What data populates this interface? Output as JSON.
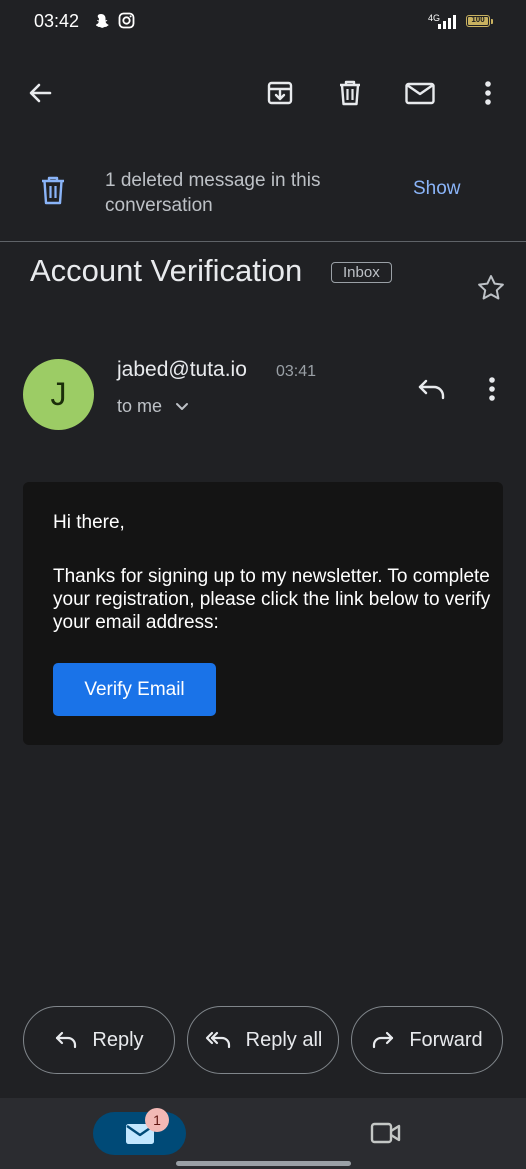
{
  "status_bar": {
    "time": "03:42",
    "network": "4G",
    "battery": "100",
    "battery_level": 1.0
  },
  "toolbar": {
    "icons": [
      "back-arrow-icon",
      "archive-icon",
      "delete-icon",
      "mark-unread-icon",
      "more-vert-icon"
    ]
  },
  "banner": {
    "text": "1 deleted message in this conversation",
    "action": "Show"
  },
  "email": {
    "subject": "Account Verification",
    "label": "Inbox",
    "sender": "jabed@tuta.io",
    "time": "03:41",
    "recipient": "to me",
    "avatar_letter": "J",
    "greeting": "Hi there,",
    "message": "Thanks for signing up to my newsletter. To complete your registration, please click the link below to verify your email address:",
    "button": "Verify Email"
  },
  "actions": {
    "reply": "Reply",
    "reply_all": "Reply all",
    "forward": "Forward"
  },
  "bottom_nav": {
    "mail_badge": "1"
  },
  "colors": {
    "background": "#202124",
    "accent": "#8ab4f8",
    "button": "#1a73e8",
    "avatar": "#9ccc65"
  }
}
